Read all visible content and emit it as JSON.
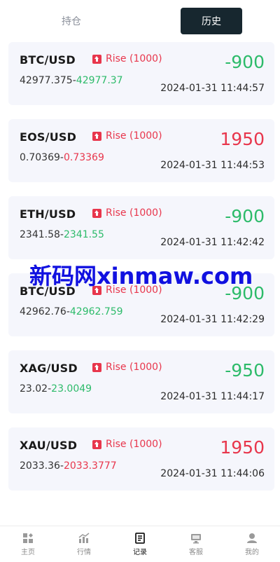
{
  "tabs": [
    {
      "label": "持仓",
      "active": false
    },
    {
      "label": "历史",
      "active": true
    }
  ],
  "records": [
    {
      "pair": "BTC/USD",
      "direction": "Rise",
      "amount": "(1000)",
      "open_price": "42977.375",
      "close_price": "42977.37",
      "close_color": "green",
      "pnl": "-900",
      "pnl_color": "green",
      "time": "2024-01-31 11:44:57"
    },
    {
      "pair": "EOS/USD",
      "direction": "Rise",
      "amount": "(1000)",
      "open_price": "0.70369",
      "close_price": "0.73369",
      "close_color": "red",
      "pnl": "1950",
      "pnl_color": "red",
      "time": "2024-01-31 11:44:53"
    },
    {
      "pair": "ETH/USD",
      "direction": "Rise",
      "amount": "(1000)",
      "open_price": "2341.58",
      "close_price": "2341.55",
      "close_color": "green",
      "pnl": "-900",
      "pnl_color": "green",
      "time": "2024-01-31 11:42:42"
    },
    {
      "pair": "BTC/USD",
      "direction": "Rise",
      "amount": "(1000)",
      "open_price": "42962.76",
      "close_price": "42962.759",
      "close_color": "green",
      "pnl": "-900",
      "pnl_color": "green",
      "time": "2024-01-31 11:42:29"
    },
    {
      "pair": "XAG/USD",
      "direction": "Rise",
      "amount": "(1000)",
      "open_price": "23.02",
      "close_price": "23.0049",
      "close_color": "green",
      "pnl": "-950",
      "pnl_color": "green",
      "time": "2024-01-31 11:44:17"
    },
    {
      "pair": "XAU/USD",
      "direction": "Rise",
      "amount": "(1000)",
      "open_price": "2033.36",
      "close_price": "2033.3777",
      "close_color": "red",
      "pnl": "1950",
      "pnl_color": "red",
      "time": "2024-01-31 11:44:06"
    }
  ],
  "price_separator": "-",
  "watermark": "新码网xinmaw.com",
  "colors": {
    "rise": "#e8364c",
    "fall": "#2dbb6a",
    "active_tab": "#17272f",
    "card_bg": "#f5f6fc",
    "watermark": "#1010e0"
  },
  "bottom_nav": [
    {
      "label": "主页",
      "icon": "home-icon",
      "active": false
    },
    {
      "label": "行情",
      "icon": "market-chart-icon",
      "active": false
    },
    {
      "label": "记录",
      "icon": "records-icon",
      "active": true
    },
    {
      "label": "客服",
      "icon": "customer-service-icon",
      "active": false
    },
    {
      "label": "我的",
      "icon": "profile-icon",
      "active": false
    }
  ]
}
